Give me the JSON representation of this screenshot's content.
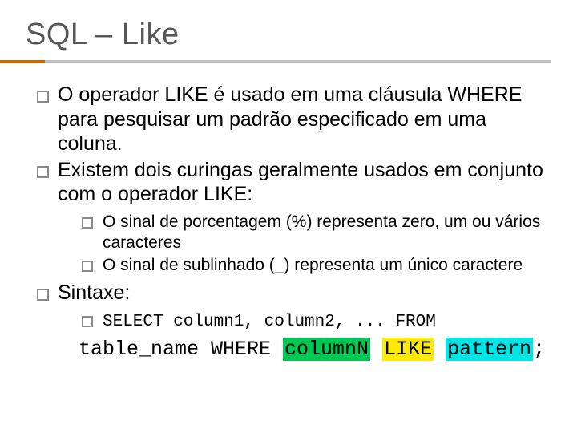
{
  "title": "SQL – Like",
  "bullets": {
    "b1": "O operador LIKE é usado em uma cláusula WHERE para pesquisar um padrão especificado em uma coluna.",
    "b2": "Existem dois curingas geralmente usados em conjunto com o operador LIKE:",
    "b2_sub1": "O sinal de porcentagem (%) representa zero, um ou vários caracteres",
    "b2_sub2": "O sinal de sublinhado (_) representa um único caractere",
    "b3": "Sintaxe:"
  },
  "syntax": {
    "lead": "SELECT column1, column2, ... FROM",
    "line2_pre": "table_name WHERE ",
    "col": "columnN",
    "sp1": " ",
    "like": "LIKE",
    "sp2": " ",
    "pattern": "pattern",
    "semicolon": ";"
  }
}
